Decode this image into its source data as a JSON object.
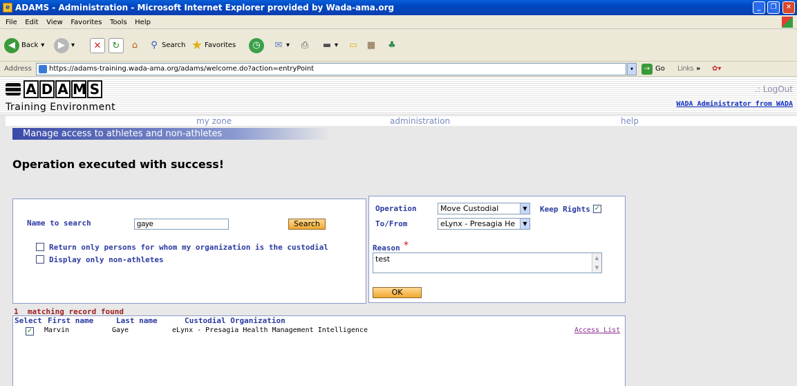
{
  "window": {
    "title": "ADAMS - Administration - Microsoft Internet Explorer provided by Wada-ama.org"
  },
  "menu": [
    "File",
    "Edit",
    "View",
    "Favorites",
    "Tools",
    "Help"
  ],
  "toolbar": {
    "back_label": "Back",
    "search_label": "Search",
    "favorites_label": "Favorites"
  },
  "address": {
    "label": "Address",
    "url": "https://adams-training.wada-ama.org/adams/welcome.do?action=entryPoint",
    "go_label": "Go",
    "links_label": "Links"
  },
  "logo": {
    "letters": [
      "A",
      "D",
      "A",
      "M",
      "S"
    ],
    "subtitle": "Training Environment"
  },
  "header": {
    "logout": ".: LogOut",
    "user": "WADA Administrator from WADA"
  },
  "nav": {
    "my_zone": "my zone",
    "administration": "administration",
    "help": "help"
  },
  "section_title": "Manage access to athletes and non-athletes",
  "message": "Operation executed with success!",
  "search": {
    "name_label": "Name to search",
    "name_value": "gaye",
    "button": "Search",
    "custodial_only": "Return only persons for whom my organization is the custodial",
    "non_athletes": "Display only non-athletes"
  },
  "operation": {
    "op_label": "Operation",
    "op_value": "Move Custodial",
    "keep_rights": "Keep Rights",
    "tofrom_label": "To/From",
    "tofrom_value": "eLynx - Presagia He",
    "reason_label": "Reason",
    "reason_required": "*",
    "reason_value": "test",
    "ok": "OK"
  },
  "results": {
    "count": "1",
    "count_text": "matching record found",
    "columns": [
      "Select",
      "First name",
      "Last name",
      "Custodial Organization"
    ],
    "rows": [
      {
        "first": "Marvin",
        "last": "Gaye",
        "org": "eLynx - Presagia Health Management Intelligence",
        "action": "Access List"
      }
    ]
  }
}
